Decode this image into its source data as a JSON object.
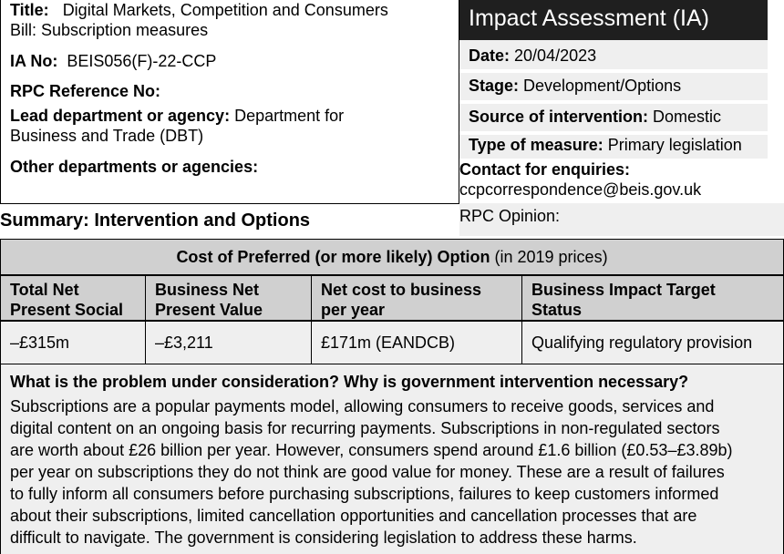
{
  "left": {
    "title_label": "Title:",
    "title_line1": "Digital Markets, Competition and Consumers",
    "title_line2": "Bill: Subscription measures",
    "ia_no_label": "IA No:",
    "ia_no_value": "BEIS056(F)-22-CCP",
    "rpc_ref_label": "RPC Reference No:",
    "lead_label": "Lead department or agency:",
    "lead_value_a": "Department for",
    "lead_value_b": "Business and Trade (DBT)",
    "other_label": "Other departments or agencies:"
  },
  "right": {
    "header": "Impact Assessment (IA)",
    "date_label": "Date:",
    "date_value": "20/04/2023",
    "stage_label": "Stage:",
    "stage_value": "Development/Options",
    "source_label": "Source of intervention:",
    "source_value": "Domestic",
    "type_label": "Type of measure:",
    "type_value": "Primary legislation",
    "contact_label": "Contact for enquiries:",
    "contact_value": "ccpcorrespondence@beis.gov.uk",
    "rpc_opinion": "RPC Opinion:"
  },
  "summary_title": "Summary: Intervention and Options",
  "cost": {
    "heading_bold": "Cost of Preferred (or more likely) Option",
    "heading_rest": " (in 2019 prices)",
    "headers": [
      [
        "Total Net",
        "Present Social"
      ],
      [
        "Business Net",
        "Present Value"
      ],
      [
        "Net cost to business",
        "per year"
      ],
      [
        "Business Impact Target",
        "Status"
      ]
    ],
    "values": [
      "–£315m",
      "–£3,211",
      "£171m (EANDCB)",
      "Qualifying regulatory provision"
    ]
  },
  "problem": {
    "question": "What is the problem under consideration? Why is government intervention necessary?",
    "lines": [
      "Subscriptions are a popular payments model, allowing consumers to receive goods, services and",
      "digital content on an ongoing basis for recurring payments. Subscriptions in non-regulated sectors",
      "are worth about £26 billion per year. However, consumers spend around £1.6 billion (£0.53–£3.89b)",
      "per year on subscriptions they do not think are good value for money. These are a result of failures",
      "to fully inform all consumers before purchasing subscriptions, failures to keep customers informed",
      "about their subscriptions, limited cancellation opportunities and cancellation processes that are",
      "difficult to navigate. The government is considering legislation to address these harms."
    ]
  }
}
